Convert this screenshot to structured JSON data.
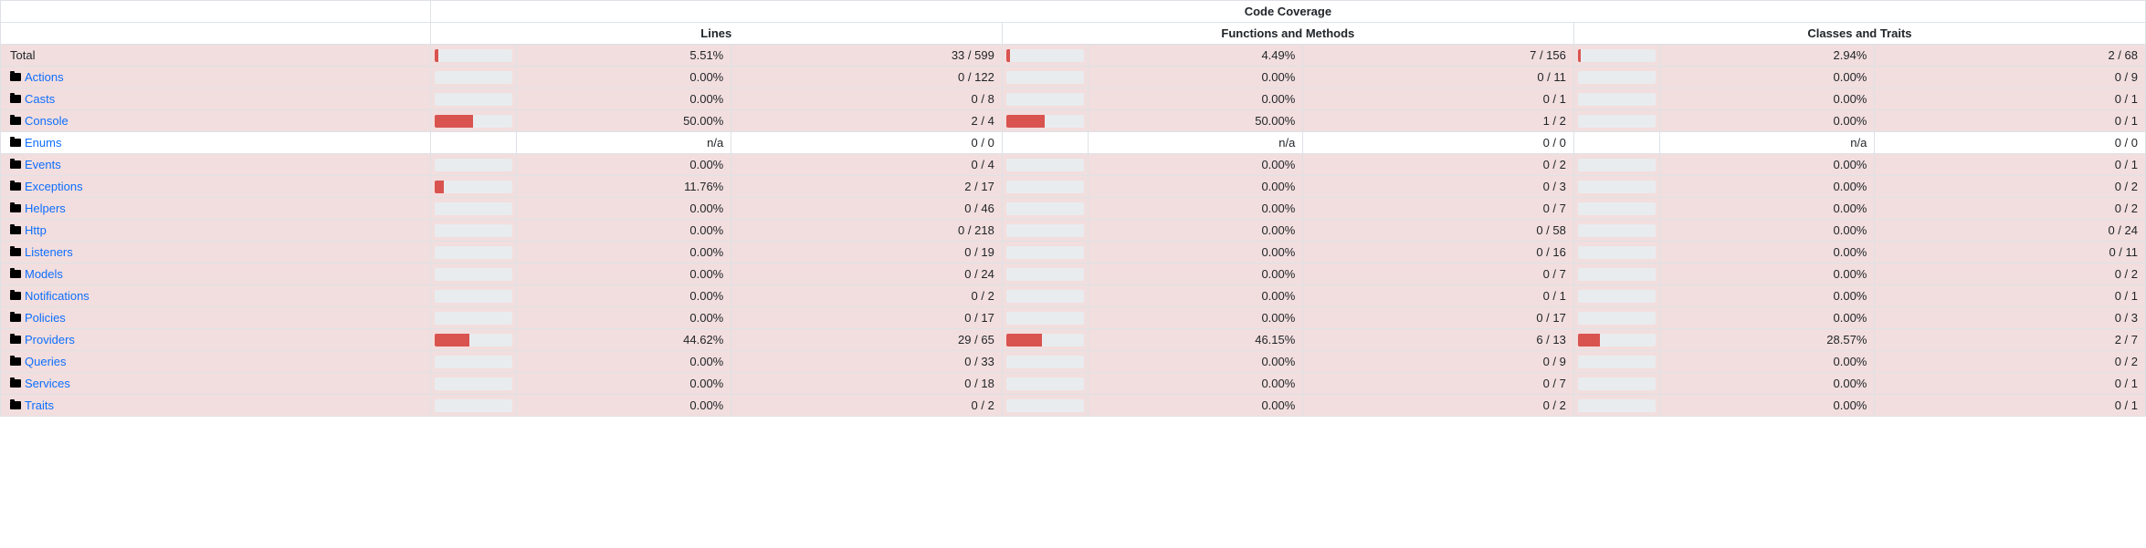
{
  "headers": {
    "super": "Code Coverage",
    "lines": "Lines",
    "functions": "Functions and Methods",
    "classes": "Classes and Traits"
  },
  "rows": [
    {
      "name": "Total",
      "link": false,
      "cls": "danger",
      "lines": {
        "bar": 5.51,
        "pct": "5.51%",
        "frac": "33 / 599"
      },
      "funcs": {
        "bar": 4.49,
        "pct": "4.49%",
        "frac": "7 / 156"
      },
      "classes": {
        "bar": 2.94,
        "pct": "2.94%",
        "frac": "2 / 68"
      }
    },
    {
      "name": "Actions",
      "link": true,
      "cls": "danger",
      "lines": {
        "bar": 0,
        "pct": "0.00%",
        "frac": "0 / 122"
      },
      "funcs": {
        "bar": 0,
        "pct": "0.00%",
        "frac": "0 / 11"
      },
      "classes": {
        "bar": 0,
        "pct": "0.00%",
        "frac": "0 / 9"
      }
    },
    {
      "name": "Casts",
      "link": true,
      "cls": "danger",
      "lines": {
        "bar": 0,
        "pct": "0.00%",
        "frac": "0 / 8"
      },
      "funcs": {
        "bar": 0,
        "pct": "0.00%",
        "frac": "0 / 1"
      },
      "classes": {
        "bar": 0,
        "pct": "0.00%",
        "frac": "0 / 1"
      }
    },
    {
      "name": "Console",
      "link": true,
      "cls": "danger",
      "lines": {
        "bar": 50,
        "pct": "50.00%",
        "frac": "2 / 4"
      },
      "funcs": {
        "bar": 50,
        "pct": "50.00%",
        "frac": "1 / 2"
      },
      "classes": {
        "bar": 0,
        "pct": "0.00%",
        "frac": "0 / 1"
      }
    },
    {
      "name": "Enums",
      "link": true,
      "cls": "neutral",
      "lines": {
        "bar": null,
        "pct": "n/a",
        "frac": "0 / 0"
      },
      "funcs": {
        "bar": null,
        "pct": "n/a",
        "frac": "0 / 0"
      },
      "classes": {
        "bar": null,
        "pct": "n/a",
        "frac": "0 / 0"
      }
    },
    {
      "name": "Events",
      "link": true,
      "cls": "danger",
      "lines": {
        "bar": 0,
        "pct": "0.00%",
        "frac": "0 / 4"
      },
      "funcs": {
        "bar": 0,
        "pct": "0.00%",
        "frac": "0 / 2"
      },
      "classes": {
        "bar": 0,
        "pct": "0.00%",
        "frac": "0 / 1"
      }
    },
    {
      "name": "Exceptions",
      "link": true,
      "cls": "danger",
      "lines": {
        "bar": 11.76,
        "pct": "11.76%",
        "frac": "2 / 17"
      },
      "funcs": {
        "bar": 0,
        "pct": "0.00%",
        "frac": "0 / 3"
      },
      "classes": {
        "bar": 0,
        "pct": "0.00%",
        "frac": "0 / 2"
      }
    },
    {
      "name": "Helpers",
      "link": true,
      "cls": "danger",
      "lines": {
        "bar": 0,
        "pct": "0.00%",
        "frac": "0 / 46"
      },
      "funcs": {
        "bar": 0,
        "pct": "0.00%",
        "frac": "0 / 7"
      },
      "classes": {
        "bar": 0,
        "pct": "0.00%",
        "frac": "0 / 2"
      }
    },
    {
      "name": "Http",
      "link": true,
      "cls": "danger",
      "lines": {
        "bar": 0,
        "pct": "0.00%",
        "frac": "0 / 218"
      },
      "funcs": {
        "bar": 0,
        "pct": "0.00%",
        "frac": "0 / 58"
      },
      "classes": {
        "bar": 0,
        "pct": "0.00%",
        "frac": "0 / 24"
      }
    },
    {
      "name": "Listeners",
      "link": true,
      "cls": "danger",
      "lines": {
        "bar": 0,
        "pct": "0.00%",
        "frac": "0 / 19"
      },
      "funcs": {
        "bar": 0,
        "pct": "0.00%",
        "frac": "0 / 16"
      },
      "classes": {
        "bar": 0,
        "pct": "0.00%",
        "frac": "0 / 11"
      }
    },
    {
      "name": "Models",
      "link": true,
      "cls": "danger",
      "lines": {
        "bar": 0,
        "pct": "0.00%",
        "frac": "0 / 24"
      },
      "funcs": {
        "bar": 0,
        "pct": "0.00%",
        "frac": "0 / 7"
      },
      "classes": {
        "bar": 0,
        "pct": "0.00%",
        "frac": "0 / 2"
      }
    },
    {
      "name": "Notifications",
      "link": true,
      "cls": "danger",
      "lines": {
        "bar": 0,
        "pct": "0.00%",
        "frac": "0 / 2"
      },
      "funcs": {
        "bar": 0,
        "pct": "0.00%",
        "frac": "0 / 1"
      },
      "classes": {
        "bar": 0,
        "pct": "0.00%",
        "frac": "0 / 1"
      }
    },
    {
      "name": "Policies",
      "link": true,
      "cls": "danger",
      "lines": {
        "bar": 0,
        "pct": "0.00%",
        "frac": "0 / 17"
      },
      "funcs": {
        "bar": 0,
        "pct": "0.00%",
        "frac": "0 / 17"
      },
      "classes": {
        "bar": 0,
        "pct": "0.00%",
        "frac": "0 / 3"
      }
    },
    {
      "name": "Providers",
      "link": true,
      "cls": "danger",
      "lines": {
        "bar": 44.62,
        "pct": "44.62%",
        "frac": "29 / 65"
      },
      "funcs": {
        "bar": 46.15,
        "pct": "46.15%",
        "frac": "6 / 13"
      },
      "classes": {
        "bar": 28.57,
        "pct": "28.57%",
        "frac": "2 / 7"
      }
    },
    {
      "name": "Queries",
      "link": true,
      "cls": "danger",
      "lines": {
        "bar": 0,
        "pct": "0.00%",
        "frac": "0 / 33"
      },
      "funcs": {
        "bar": 0,
        "pct": "0.00%",
        "frac": "0 / 9"
      },
      "classes": {
        "bar": 0,
        "pct": "0.00%",
        "frac": "0 / 2"
      }
    },
    {
      "name": "Services",
      "link": true,
      "cls": "danger",
      "lines": {
        "bar": 0,
        "pct": "0.00%",
        "frac": "0 / 18"
      },
      "funcs": {
        "bar": 0,
        "pct": "0.00%",
        "frac": "0 / 7"
      },
      "classes": {
        "bar": 0,
        "pct": "0.00%",
        "frac": "0 / 1"
      }
    },
    {
      "name": "Traits",
      "link": true,
      "cls": "danger",
      "lines": {
        "bar": 0,
        "pct": "0.00%",
        "frac": "0 / 2"
      },
      "funcs": {
        "bar": 0,
        "pct": "0.00%",
        "frac": "0 / 2"
      },
      "classes": {
        "bar": 0,
        "pct": "0.00%",
        "frac": "0 / 1"
      }
    }
  ]
}
